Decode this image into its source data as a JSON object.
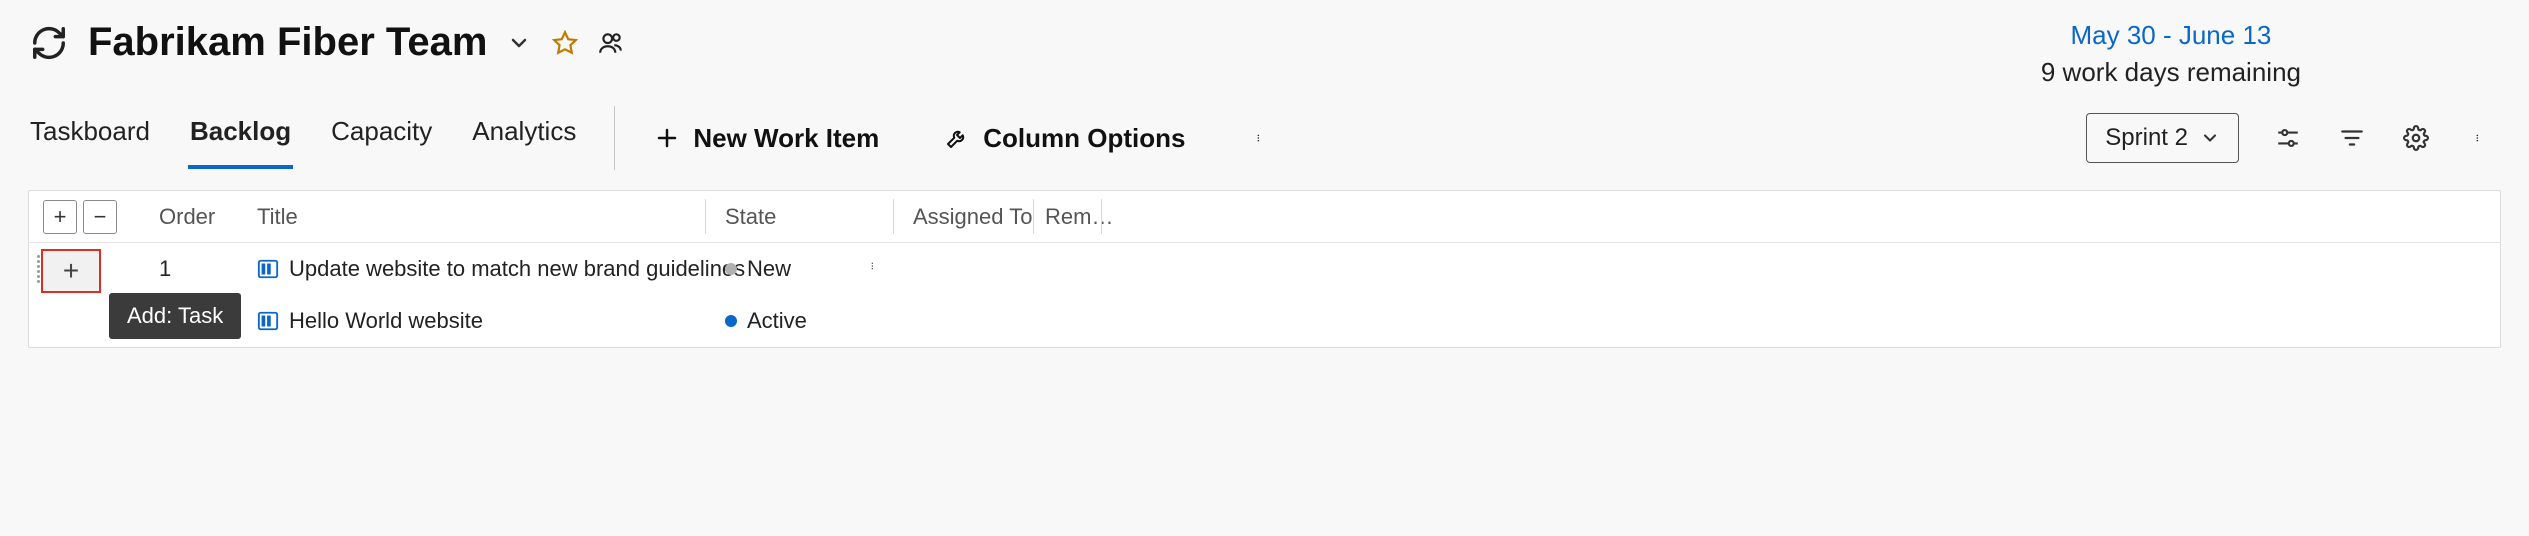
{
  "header": {
    "title": "Fabrikam Fiber Team",
    "date_range": "May 30 - June 13",
    "work_days": "9 work days remaining"
  },
  "tabs": {
    "t0": "Taskboard",
    "t1": "Backlog",
    "t2": "Capacity",
    "t3": "Analytics",
    "selected": 1
  },
  "actions": {
    "new_item": "New Work Item",
    "col_options": "Column Options"
  },
  "sprint_picker": {
    "label": "Sprint 2"
  },
  "columns": {
    "order": "Order",
    "title": "Title",
    "state": "State",
    "assigned": "Assigned To",
    "rem": "Rem…"
  },
  "rows": [
    {
      "order": "1",
      "title": "Update website to match new brand guidelines",
      "state": "New",
      "state_kind": "new"
    },
    {
      "order": "",
      "title": "Hello World website",
      "state": "Active",
      "state_kind": "active"
    }
  ],
  "tooltip": {
    "add_task": "Add: Task"
  }
}
